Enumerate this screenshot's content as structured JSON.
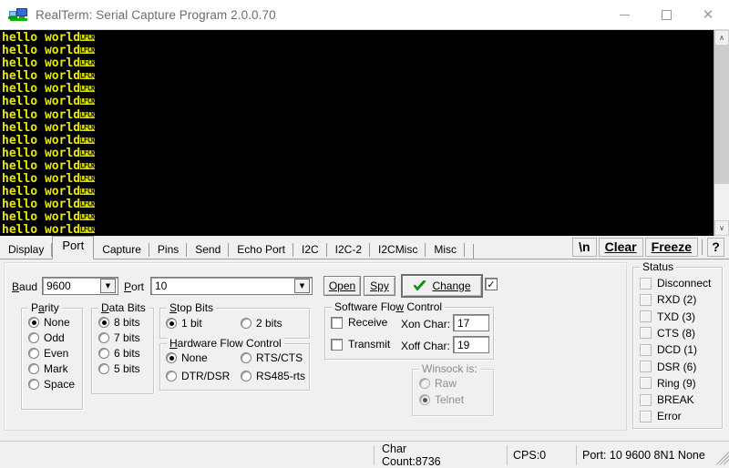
{
  "window": {
    "title": "RealTerm: Serial Capture Program 2.0.0.70",
    "icon": "computer-monitor-icon",
    "minimize_label": "—",
    "maximize_label": "□",
    "close_label": "✕"
  },
  "terminal": {
    "text_color": "#e8e800",
    "background_color": "#000000",
    "line_text": "hello world",
    "control_chars": [
      "LF",
      "CR"
    ],
    "line_count": 16,
    "trailing_line_control": "CR",
    "lines": [
      "hello world",
      "hello world",
      "hello world",
      "hello world",
      "hello world",
      "hello world",
      "hello world",
      "hello world",
      "hello world",
      "hello world",
      "hello world",
      "hello world",
      "hello world",
      "hello world",
      "hello world",
      "hello world"
    ],
    "scrollbar": {
      "up_arrow": "∧",
      "down_arrow": "∨"
    }
  },
  "tabs": [
    {
      "label": "Display",
      "active": false
    },
    {
      "label": "Port",
      "active": true
    },
    {
      "label": "Capture",
      "active": false
    },
    {
      "label": "Pins",
      "active": false
    },
    {
      "label": "Send",
      "active": false
    },
    {
      "label": "Echo Port",
      "active": false
    },
    {
      "label": "I2C",
      "active": false
    },
    {
      "label": "I2C-2",
      "active": false
    },
    {
      "label": "I2CMisc",
      "active": false
    },
    {
      "label": "Misc",
      "active": false
    }
  ],
  "toolbar": {
    "newline_label": "\\n",
    "clear_label": "Clear",
    "clear_accel": "C",
    "freeze_label": "Freeze",
    "freeze_accel": "F",
    "help_label": "?"
  },
  "port_tab": {
    "baud": {
      "label": "Baud",
      "accel": "B",
      "value": "9600"
    },
    "port": {
      "label": "Port",
      "accel": "P",
      "value": "10"
    },
    "open_button": {
      "label": "Open",
      "accel": "O"
    },
    "spy_button": {
      "label": "Spy",
      "accel": "y"
    },
    "change_button": {
      "label": "Change",
      "accel": "n",
      "icon": "green-check-icon"
    },
    "change_checkbox": {
      "checked": true,
      "mark": "✓"
    },
    "parity": {
      "title": "Parity",
      "accel": "a",
      "options": [
        "None",
        "Odd",
        "Even",
        "Mark",
        "Space"
      ],
      "selected": "None"
    },
    "data_bits": {
      "title": "Data Bits",
      "accel": "D",
      "options": [
        "8 bits",
        "7 bits",
        "6 bits",
        "5 bits"
      ],
      "selected": "8 bits"
    },
    "stop_bits": {
      "title": "Stop Bits",
      "accel": "S",
      "options": [
        "1 bit",
        "2 bits"
      ],
      "selected": "1 bit"
    },
    "hardware_flow_control": {
      "title": "Hardware Flow Control",
      "accel": "H",
      "options": [
        "None",
        "RTS/CTS",
        "DTR/DSR",
        "RS485-rts"
      ],
      "selected": "None"
    },
    "software_flow_control": {
      "title": "Software Flow Control",
      "accel": "w",
      "receive_label": "Receive",
      "receive_checked": false,
      "transmit_label": "Transmit",
      "transmit_checked": false,
      "xon_label": "Xon Char:",
      "xon_value": "17",
      "xoff_label": "Xoff Char:",
      "xoff_value": "19"
    },
    "winsock": {
      "title": "Winsock is:",
      "options": [
        "Raw",
        "Telnet"
      ],
      "selected": "Telnet",
      "enabled": false
    },
    "status": {
      "title": "Status",
      "items": [
        {
          "label": "Disconnect",
          "on": false
        },
        {
          "label": "RXD (2)",
          "on": false
        },
        {
          "label": "TXD (3)",
          "on": false
        },
        {
          "label": "CTS (8)",
          "on": false
        },
        {
          "label": "DCD (1)",
          "on": false
        },
        {
          "label": "DSR (6)",
          "on": false
        },
        {
          "label": "Ring (9)",
          "on": false
        },
        {
          "label": "BREAK",
          "on": false
        },
        {
          "label": "Error",
          "on": false
        }
      ]
    }
  },
  "statusbar": {
    "char_count": "Char Count:8736",
    "cps": "CPS:0",
    "port_info": "Port: 10 9600 8N1 None"
  }
}
